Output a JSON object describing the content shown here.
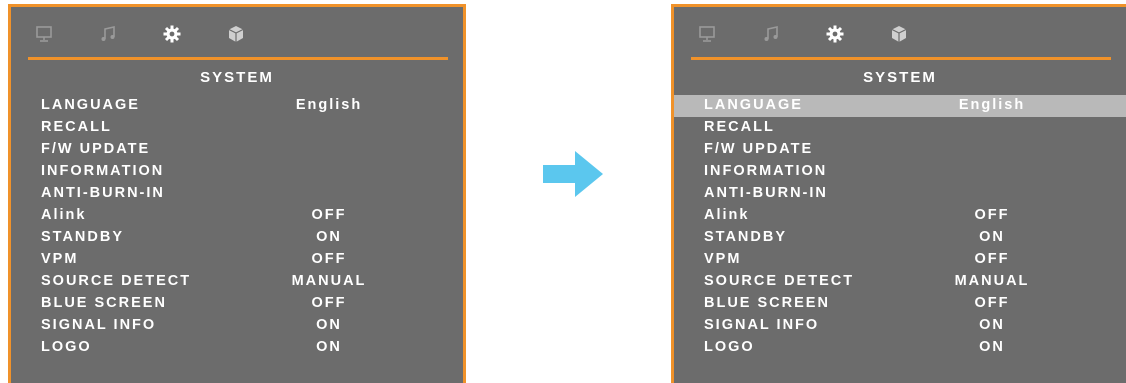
{
  "colors": {
    "osd_background": "#6c6c6c",
    "accent_border": "#f0922a",
    "selected_row": "#b9b9b9",
    "arrow": "#5bc7ee"
  },
  "tab_icons": [
    "monitor-icon",
    "music-note-icon",
    "gear-icon",
    "cube-icon"
  ],
  "active_tab": "gear-icon",
  "before": {
    "title": "SYSTEM",
    "selected_row": null,
    "rows": [
      {
        "label": "LANGUAGE",
        "value": "English"
      },
      {
        "label": "RECALL",
        "value": ""
      },
      {
        "label": "F/W UPDATE",
        "value": ""
      },
      {
        "label": "INFORMATION",
        "value": ""
      },
      {
        "label": "ANTI-BURN-IN",
        "value": ""
      },
      {
        "label": "Alink",
        "value": "OFF"
      },
      {
        "label": "STANDBY",
        "value": "ON"
      },
      {
        "label": "VPM",
        "value": "OFF"
      },
      {
        "label": "SOURCE DETECT",
        "value": "MANUAL"
      },
      {
        "label": "BLUE SCREEN",
        "value": "OFF"
      },
      {
        "label": "SIGNAL INFO",
        "value": "ON"
      },
      {
        "label": "LOGO",
        "value": "ON"
      }
    ]
  },
  "after": {
    "title": "SYSTEM",
    "selected_row": "LANGUAGE",
    "rows": [
      {
        "label": "LANGUAGE",
        "value": "English"
      },
      {
        "label": "RECALL",
        "value": ""
      },
      {
        "label": "F/W UPDATE",
        "value": ""
      },
      {
        "label": "INFORMATION",
        "value": ""
      },
      {
        "label": "ANTI-BURN-IN",
        "value": ""
      },
      {
        "label": "Alink",
        "value": "OFF"
      },
      {
        "label": "STANDBY",
        "value": "ON"
      },
      {
        "label": "VPM",
        "value": "OFF"
      },
      {
        "label": "SOURCE DETECT",
        "value": "MANUAL"
      },
      {
        "label": "BLUE SCREEN",
        "value": "OFF"
      },
      {
        "label": "SIGNAL INFO",
        "value": "ON"
      },
      {
        "label": "LOGO",
        "value": "ON"
      }
    ]
  }
}
